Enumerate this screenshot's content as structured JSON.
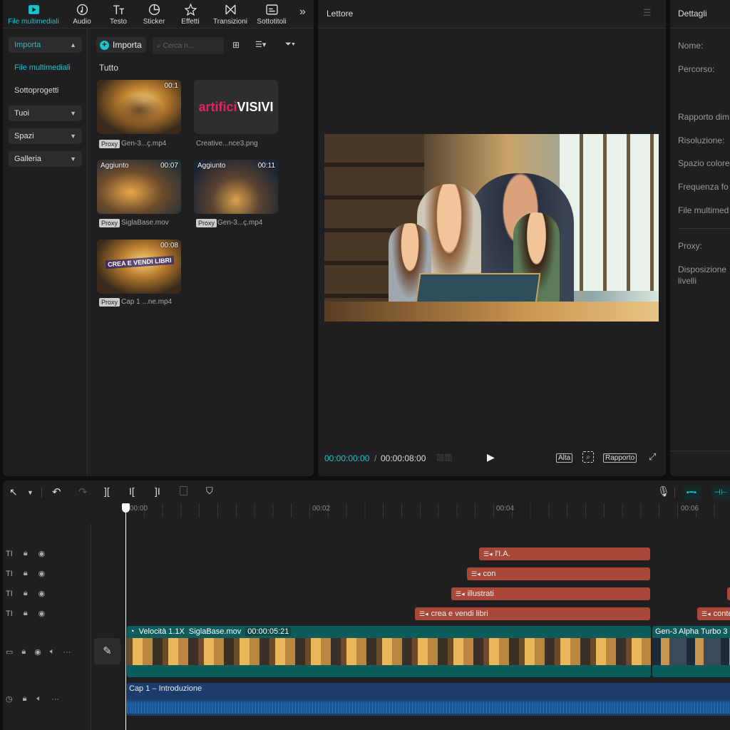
{
  "toolbar": {
    "items": [
      {
        "label": "File multimediali",
        "icon": "media-icon"
      },
      {
        "label": "Audio",
        "icon": "audio-icon"
      },
      {
        "label": "Testo",
        "icon": "text-icon"
      },
      {
        "label": "Sticker",
        "icon": "sticker-icon"
      },
      {
        "label": "Effetti",
        "icon": "effects-icon"
      },
      {
        "label": "Transizioni",
        "icon": "transitions-icon"
      },
      {
        "label": "Sottotitoli",
        "icon": "subtitles-icon"
      }
    ],
    "more": "»"
  },
  "nav": {
    "importa": "Importa",
    "file_multimediali": "File multimediali",
    "sottoprogetti": "Sottoprogetti",
    "tuoi": "Tuoi",
    "spazi": "Spazi",
    "galleria": "Galleria"
  },
  "media": {
    "import_btn": "Importa",
    "search_placeholder": "Cerca n...",
    "tutto": "Tutto",
    "proxy_label": "Proxy",
    "items": [
      {
        "name": "Gen-3...ç.mp4",
        "badge": "",
        "duration": "00:1",
        "proxy": true
      },
      {
        "name": "Creative...nce3.png",
        "badge": "",
        "duration": "",
        "proxy": false,
        "logo_a": "artifici",
        "logo_b": "VISIVI"
      },
      {
        "name": "SiglaBase.mov",
        "badge": "Aggiunto",
        "duration": "00:07",
        "proxy": true
      },
      {
        "name": "Gen-3...ç.mp4",
        "badge": "Aggiunto",
        "duration": "00:11",
        "proxy": true
      },
      {
        "name": "Cap 1 ...ne.mp4",
        "badge": "",
        "duration": "00:08",
        "proxy": true,
        "overlay": "CREA E VENDI LIBRI"
      }
    ]
  },
  "player": {
    "title": "Lettore",
    "time_current": "00:00:00:00",
    "time_total": "00:00:08:00",
    "alta": "Alta",
    "rapporto": "Rapporto"
  },
  "details": {
    "title": "Dettagli",
    "fields": [
      "Nome:",
      "Percorso:",
      "Rapporto dim",
      "Risoluzione:",
      "Spazio colore",
      "Frequenza fo",
      "File multimed",
      "Proxy:",
      "Disposizione",
      "livelli"
    ]
  },
  "timeline": {
    "ticks": [
      "00:00",
      "00:02",
      "00:04",
      "00:06"
    ],
    "text_clips": [
      {
        "label": "l'I.A."
      },
      {
        "label": "con"
      },
      {
        "label": "illustrati"
      },
      {
        "label": "crea e vendi libri"
      },
      {
        "label": "conte"
      }
    ],
    "video_clip": {
      "speed": "Velocità 1.1X",
      "name": "SiglaBase.mov",
      "duration": "00:00:05:21",
      "next": "Gen-3 Alpha Turbo 3"
    },
    "audio_clip": {
      "name": "Cap 1 – Introduzione"
    }
  },
  "colors": {
    "accent": "#19c3c9",
    "text_clip": "#a94838",
    "video_track": "#0d5c5c",
    "audio_track": "#1c3d6b"
  }
}
